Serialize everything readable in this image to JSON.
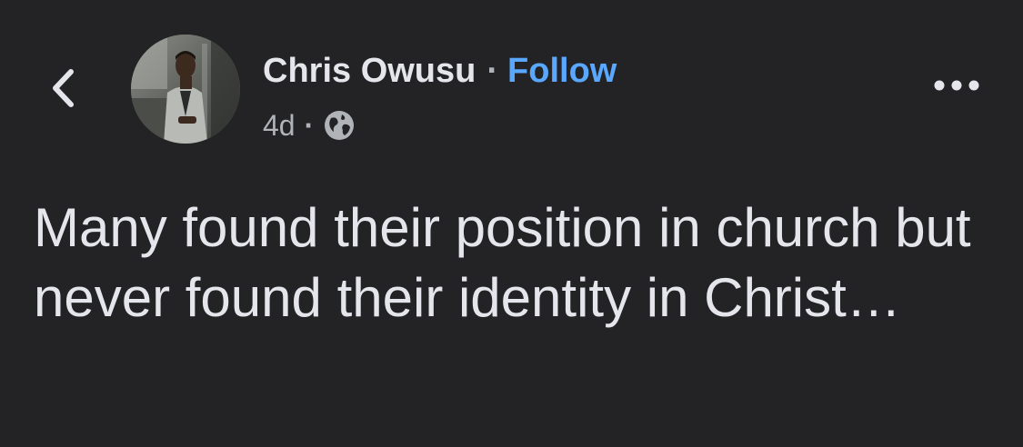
{
  "header": {
    "back_icon": "chevron-left-icon",
    "author_name": "Chris Owusu",
    "separator": "·",
    "follow_label": "Follow",
    "timestamp": "4d",
    "meta_separator": "·",
    "audience_icon": "globe-icon",
    "more_icon": "more-horizontal-icon"
  },
  "post": {
    "text": "Many found their position in church but never found their identity in Christ…"
  },
  "colors": {
    "background": "#232325",
    "text_primary": "#e4e6eb",
    "text_secondary": "#b0b3b8",
    "link": "#5aa7ff"
  }
}
